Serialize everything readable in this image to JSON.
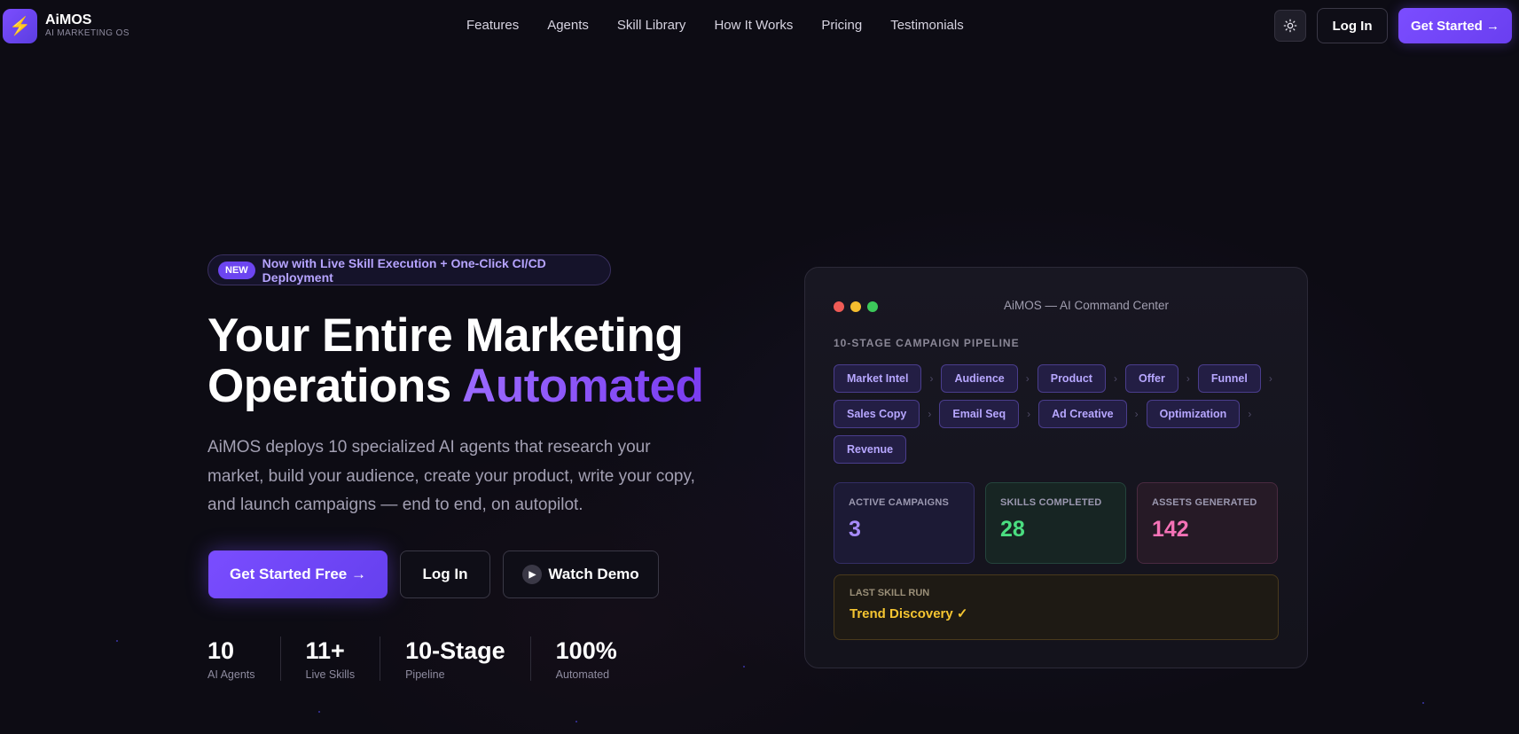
{
  "brand": {
    "name": "AiMOS",
    "tagline": "AI MARKETING OS",
    "logo_icon": "lightning-icon"
  },
  "nav": [
    "Features",
    "Agents",
    "Skill Library",
    "How It Works",
    "Pricing",
    "Testimonials"
  ],
  "header_actions": {
    "theme_icon": "sun-icon",
    "login": "Log In",
    "get_started": "Get Started →"
  },
  "hero": {
    "badge": "NEW",
    "badge_text": "Now with Live Skill Execution + One-Click CI/CD Deployment",
    "title_line1": "Your Entire Marketing",
    "title_line2_plain": "Operations ",
    "title_line2_accent": "Automated",
    "description": "AiMOS deploys 10 specialized AI agents that research your market, build your audience, create your product, write your copy, and launch campaigns — end to end, on autopilot.",
    "cta_primary": "Get Started Free →",
    "cta_login": "Log In",
    "cta_demo": "Watch Demo",
    "stats": [
      {
        "value": "10",
        "label": "AI Agents"
      },
      {
        "value": "11+",
        "label": "Live Skills"
      },
      {
        "value": "10-Stage",
        "label": "Pipeline"
      },
      {
        "value": "100%",
        "label": "Automated"
      }
    ]
  },
  "command_center": {
    "title": "AiMOS — AI Command Center",
    "pipeline_label": "10-STAGE CAMPAIGN PIPELINE",
    "pipeline": [
      "Market Intel",
      "Audience",
      "Product",
      "Offer",
      "Funnel",
      "Sales Copy",
      "Email Seq",
      "Ad Creative",
      "Optimization",
      "Revenue"
    ],
    "metrics": [
      {
        "label": "ACTIVE CAMPAIGNS",
        "value": "3",
        "color": "#a78bfa"
      },
      {
        "label": "SKILLS COMPLETED",
        "value": "28",
        "color": "#4ade80"
      },
      {
        "label": "ASSETS GENERATED",
        "value": "142",
        "color": "#f472b6"
      }
    ],
    "last_run_label": "LAST SKILL RUN",
    "last_run_value": "Trend Discovery ✓",
    "window_dots": [
      "#ef5b56",
      "#f5bd2f",
      "#3cc95a"
    ]
  }
}
